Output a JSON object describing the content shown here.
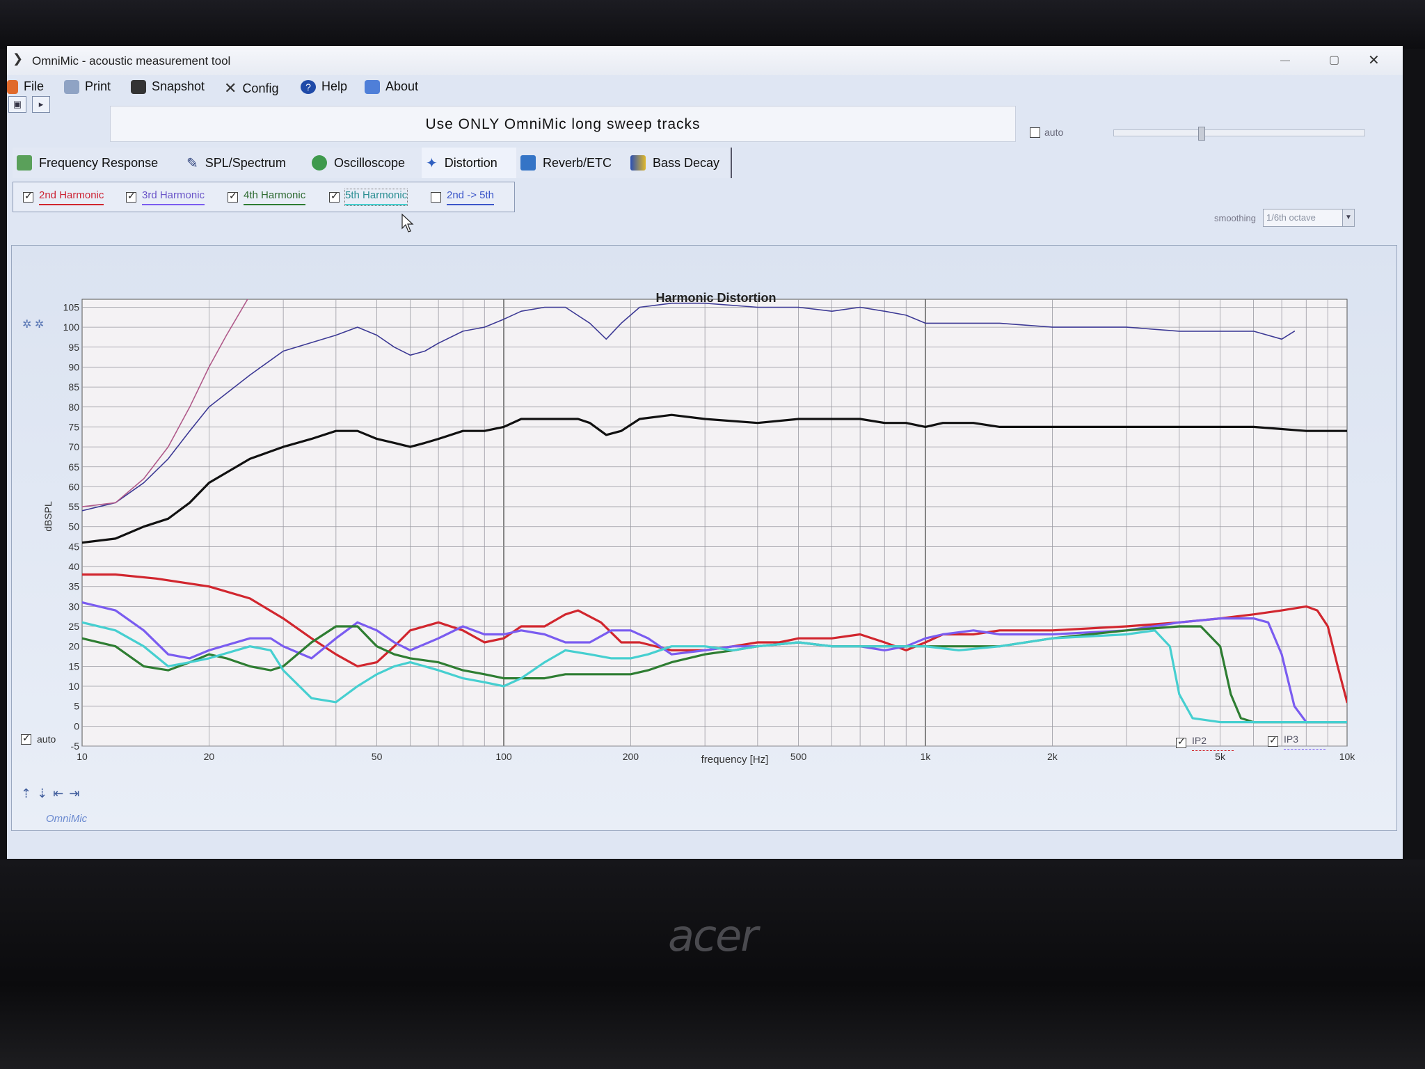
{
  "window": {
    "title": "OmniMic - acoustic measurement tool",
    "close_glyph": "✕"
  },
  "menu": {
    "items": [
      "File",
      "Print",
      "Snapshot",
      "Config",
      "Help",
      "About"
    ]
  },
  "banner": {
    "text": "Use ONLY OmniMic long sweep tracks"
  },
  "top_auto": {
    "label": "auto",
    "checked": false
  },
  "tabs": [
    {
      "label": "Frequency Response",
      "icon": "chart-icon"
    },
    {
      "label": "SPL/Spectrum",
      "icon": "mic-icon"
    },
    {
      "label": "Oscilloscope",
      "icon": "scope-icon"
    },
    {
      "label": "Distortion",
      "icon": "distortion-icon"
    },
    {
      "label": "Reverb/ETC",
      "icon": "reverb-icon"
    },
    {
      "label": "Bass Decay",
      "icon": "waterfall-icon"
    }
  ],
  "active_tab": "Distortion",
  "harmonics": [
    {
      "label": "2nd Harmonic",
      "checked": true,
      "color": "#d1262e"
    },
    {
      "label": "3rd Harmonic",
      "checked": true,
      "color": "#7a5cf0"
    },
    {
      "label": "4th Harmonic",
      "checked": true,
      "color": "#2e7d32"
    },
    {
      "label": "5th Harmonic",
      "checked": true,
      "color": "#46cfd0"
    },
    {
      "label": "2nd -> 5th",
      "checked": false,
      "color": "#3b56c9"
    }
  ],
  "smoothing": {
    "label": "smoothing",
    "value": "1/6th octave"
  },
  "left_auto": {
    "label": "auto",
    "checked": true
  },
  "brand_mark": "OmniMic",
  "legend_checks": [
    {
      "label": "IP2",
      "checked": true
    },
    {
      "label": "IP3",
      "checked": true
    }
  ],
  "chart_data": {
    "type": "line",
    "title": "Harmonic Distortion",
    "xlabel": "frequency [Hz]",
    "ylabel": "dBSPL",
    "x_scale": "log",
    "xlim": [
      10,
      10000
    ],
    "ylim": [
      -5,
      107
    ],
    "x_ticks": [
      {
        "value": 10,
        "label": "10"
      },
      {
        "value": 20,
        "label": "20"
      },
      {
        "value": 50,
        "label": "50"
      },
      {
        "value": 100,
        "label": "100"
      },
      {
        "value": 200,
        "label": "200"
      },
      {
        "value": 500,
        "label": "500"
      },
      {
        "value": 1000,
        "label": "1k"
      },
      {
        "value": 2000,
        "label": "2k"
      },
      {
        "value": 5000,
        "label": "5k"
      },
      {
        "value": 10000,
        "label": "10k"
      }
    ],
    "y_ticks": [
      105,
      100,
      95,
      90,
      85,
      80,
      75,
      70,
      65,
      60,
      55,
      50,
      45,
      40,
      35,
      30,
      25,
      20,
      15,
      10,
      5,
      0,
      -5
    ],
    "grid": true,
    "series": [
      {
        "color": "#3d3a95",
        "width": 1,
        "points": [
          [
            10,
            54
          ],
          [
            12,
            56
          ],
          [
            14,
            61
          ],
          [
            16,
            67
          ],
          [
            18,
            74
          ],
          [
            20,
            80
          ],
          [
            25,
            88
          ],
          [
            30,
            94
          ],
          [
            40,
            98
          ],
          [
            45,
            100
          ],
          [
            50,
            98
          ],
          [
            55,
            95
          ],
          [
            60,
            93
          ],
          [
            65,
            94
          ],
          [
            70,
            96
          ],
          [
            80,
            99
          ],
          [
            90,
            100
          ],
          [
            100,
            102
          ],
          [
            110,
            104
          ],
          [
            125,
            105
          ],
          [
            140,
            105
          ],
          [
            160,
            101
          ],
          [
            175,
            97
          ],
          [
            190,
            101
          ],
          [
            210,
            105
          ],
          [
            250,
            106
          ],
          [
            300,
            106
          ],
          [
            400,
            105
          ],
          [
            500,
            105
          ],
          [
            600,
            104
          ],
          [
            700,
            105
          ],
          [
            800,
            104
          ],
          [
            900,
            103
          ],
          [
            1000,
            101
          ],
          [
            1100,
            101
          ],
          [
            1300,
            101
          ],
          [
            1500,
            101
          ],
          [
            2000,
            100
          ],
          [
            3000,
            100
          ],
          [
            4000,
            99
          ],
          [
            5000,
            99
          ],
          [
            6000,
            99
          ],
          [
            7000,
            97
          ],
          [
            7500,
            99
          ]
        ]
      },
      {
        "color": "#b05a8a",
        "width": 1,
        "points": [
          [
            10,
            55
          ],
          [
            12,
            56
          ],
          [
            14,
            62
          ],
          [
            16,
            70
          ],
          [
            18,
            80
          ],
          [
            20,
            90
          ],
          [
            22,
            98
          ],
          [
            25,
            108
          ]
        ]
      },
      {
        "color": "#111111",
        "width": 2,
        "points": [
          [
            10,
            46
          ],
          [
            12,
            47
          ],
          [
            14,
            50
          ],
          [
            16,
            52
          ],
          [
            18,
            56
          ],
          [
            20,
            61
          ],
          [
            25,
            67
          ],
          [
            30,
            70
          ],
          [
            35,
            72
          ],
          [
            40,
            74
          ],
          [
            45,
            74
          ],
          [
            50,
            72
          ],
          [
            55,
            71
          ],
          [
            60,
            70
          ],
          [
            65,
            71
          ],
          [
            70,
            72
          ],
          [
            80,
            74
          ],
          [
            90,
            74
          ],
          [
            100,
            75
          ],
          [
            110,
            77
          ],
          [
            125,
            77
          ],
          [
            140,
            77
          ],
          [
            150,
            77
          ],
          [
            160,
            76
          ],
          [
            175,
            73
          ],
          [
            190,
            74
          ],
          [
            210,
            77
          ],
          [
            250,
            78
          ],
          [
            300,
            77
          ],
          [
            400,
            76
          ],
          [
            500,
            77
          ],
          [
            600,
            77
          ],
          [
            700,
            77
          ],
          [
            800,
            76
          ],
          [
            900,
            76
          ],
          [
            1000,
            75
          ],
          [
            1100,
            76
          ],
          [
            1300,
            76
          ],
          [
            1500,
            75
          ],
          [
            2000,
            75
          ],
          [
            3000,
            75
          ],
          [
            4000,
            75
          ],
          [
            5000,
            75
          ],
          [
            6000,
            75
          ],
          [
            8000,
            74
          ],
          [
            10000,
            74
          ]
        ]
      },
      {
        "color": "#d1262e",
        "width": 2,
        "points": [
          [
            10,
            38
          ],
          [
            12,
            38
          ],
          [
            15,
            37
          ],
          [
            20,
            35
          ],
          [
            25,
            32
          ],
          [
            30,
            27
          ],
          [
            35,
            22
          ],
          [
            40,
            18
          ],
          [
            45,
            15
          ],
          [
            50,
            16
          ],
          [
            55,
            20
          ],
          [
            60,
            24
          ],
          [
            70,
            26
          ],
          [
            80,
            24
          ],
          [
            90,
            21
          ],
          [
            100,
            22
          ],
          [
            110,
            25
          ],
          [
            125,
            25
          ],
          [
            140,
            28
          ],
          [
            150,
            29
          ],
          [
            170,
            26
          ],
          [
            190,
            21
          ],
          [
            210,
            21
          ],
          [
            250,
            19
          ],
          [
            300,
            19
          ],
          [
            350,
            20
          ],
          [
            400,
            21
          ],
          [
            450,
            21
          ],
          [
            500,
            22
          ],
          [
            600,
            22
          ],
          [
            700,
            23
          ],
          [
            800,
            21
          ],
          [
            900,
            19
          ],
          [
            1000,
            21
          ],
          [
            1100,
            23
          ],
          [
            1300,
            23
          ],
          [
            1500,
            24
          ],
          [
            2000,
            24
          ],
          [
            3000,
            25
          ],
          [
            4000,
            26
          ],
          [
            5000,
            27
          ],
          [
            6000,
            28
          ],
          [
            7000,
            29
          ],
          [
            8000,
            30
          ],
          [
            8500,
            29
          ],
          [
            9000,
            25
          ],
          [
            9500,
            15
          ],
          [
            10000,
            6
          ]
        ]
      },
      {
        "color": "#7a5cf0",
        "width": 2,
        "points": [
          [
            10,
            31
          ],
          [
            12,
            29
          ],
          [
            14,
            24
          ],
          [
            16,
            18
          ],
          [
            18,
            17
          ],
          [
            20,
            19
          ],
          [
            25,
            22
          ],
          [
            28,
            22
          ],
          [
            30,
            20
          ],
          [
            35,
            17
          ],
          [
            40,
            22
          ],
          [
            45,
            26
          ],
          [
            50,
            24
          ],
          [
            55,
            21
          ],
          [
            60,
            19
          ],
          [
            70,
            22
          ],
          [
            80,
            25
          ],
          [
            90,
            23
          ],
          [
            100,
            23
          ],
          [
            110,
            24
          ],
          [
            125,
            23
          ],
          [
            140,
            21
          ],
          [
            160,
            21
          ],
          [
            180,
            24
          ],
          [
            200,
            24
          ],
          [
            220,
            22
          ],
          [
            250,
            18
          ],
          [
            300,
            19
          ],
          [
            350,
            20
          ],
          [
            400,
            20
          ],
          [
            500,
            21
          ],
          [
            600,
            20
          ],
          [
            700,
            20
          ],
          [
            800,
            19
          ],
          [
            900,
            20
          ],
          [
            1000,
            22
          ],
          [
            1100,
            23
          ],
          [
            1300,
            24
          ],
          [
            1500,
            23
          ],
          [
            2000,
            23
          ],
          [
            3000,
            24
          ],
          [
            4000,
            26
          ],
          [
            5000,
            27
          ],
          [
            6000,
            27
          ],
          [
            6500,
            26
          ],
          [
            7000,
            18
          ],
          [
            7500,
            5
          ],
          [
            8000,
            1
          ],
          [
            10000,
            1
          ]
        ]
      },
      {
        "color": "#2e7d32",
        "width": 2,
        "points": [
          [
            10,
            22
          ],
          [
            12,
            20
          ],
          [
            14,
            15
          ],
          [
            16,
            14
          ],
          [
            18,
            16
          ],
          [
            20,
            18
          ],
          [
            22,
            17
          ],
          [
            25,
            15
          ],
          [
            28,
            14
          ],
          [
            30,
            15
          ],
          [
            35,
            21
          ],
          [
            40,
            25
          ],
          [
            45,
            25
          ],
          [
            50,
            20
          ],
          [
            55,
            18
          ],
          [
            60,
            17
          ],
          [
            70,
            16
          ],
          [
            80,
            14
          ],
          [
            90,
            13
          ],
          [
            100,
            12
          ],
          [
            110,
            12
          ],
          [
            125,
            12
          ],
          [
            140,
            13
          ],
          [
            160,
            13
          ],
          [
            180,
            13
          ],
          [
            200,
            13
          ],
          [
            220,
            14
          ],
          [
            250,
            16
          ],
          [
            300,
            18
          ],
          [
            350,
            19
          ],
          [
            400,
            20
          ],
          [
            500,
            21
          ],
          [
            600,
            20
          ],
          [
            700,
            20
          ],
          [
            800,
            20
          ],
          [
            900,
            20
          ],
          [
            1000,
            20
          ],
          [
            1200,
            20
          ],
          [
            1500,
            20
          ],
          [
            2000,
            22
          ],
          [
            3000,
            24
          ],
          [
            4000,
            25
          ],
          [
            4500,
            25
          ],
          [
            5000,
            20
          ],
          [
            5300,
            8
          ],
          [
            5600,
            2
          ],
          [
            6000,
            1
          ],
          [
            10000,
            1
          ]
        ]
      },
      {
        "color": "#46cfd0",
        "width": 2,
        "points": [
          [
            10,
            26
          ],
          [
            12,
            24
          ],
          [
            14,
            20
          ],
          [
            16,
            15
          ],
          [
            18,
            16
          ],
          [
            20,
            17
          ],
          [
            25,
            20
          ],
          [
            28,
            19
          ],
          [
            30,
            14
          ],
          [
            35,
            7
          ],
          [
            40,
            6
          ],
          [
            45,
            10
          ],
          [
            50,
            13
          ],
          [
            55,
            15
          ],
          [
            60,
            16
          ],
          [
            70,
            14
          ],
          [
            80,
            12
          ],
          [
            90,
            11
          ],
          [
            100,
            10
          ],
          [
            110,
            12
          ],
          [
            125,
            16
          ],
          [
            140,
            19
          ],
          [
            160,
            18
          ],
          [
            180,
            17
          ],
          [
            200,
            17
          ],
          [
            220,
            18
          ],
          [
            250,
            20
          ],
          [
            300,
            20
          ],
          [
            350,
            19
          ],
          [
            400,
            20
          ],
          [
            500,
            21
          ],
          [
            600,
            20
          ],
          [
            700,
            20
          ],
          [
            800,
            20
          ],
          [
            900,
            20
          ],
          [
            1000,
            20
          ],
          [
            1200,
            19
          ],
          [
            1500,
            20
          ],
          [
            2000,
            22
          ],
          [
            3000,
            23
          ],
          [
            3500,
            24
          ],
          [
            3800,
            20
          ],
          [
            4000,
            8
          ],
          [
            4300,
            2
          ],
          [
            5000,
            1
          ],
          [
            10000,
            1
          ]
        ]
      }
    ]
  }
}
